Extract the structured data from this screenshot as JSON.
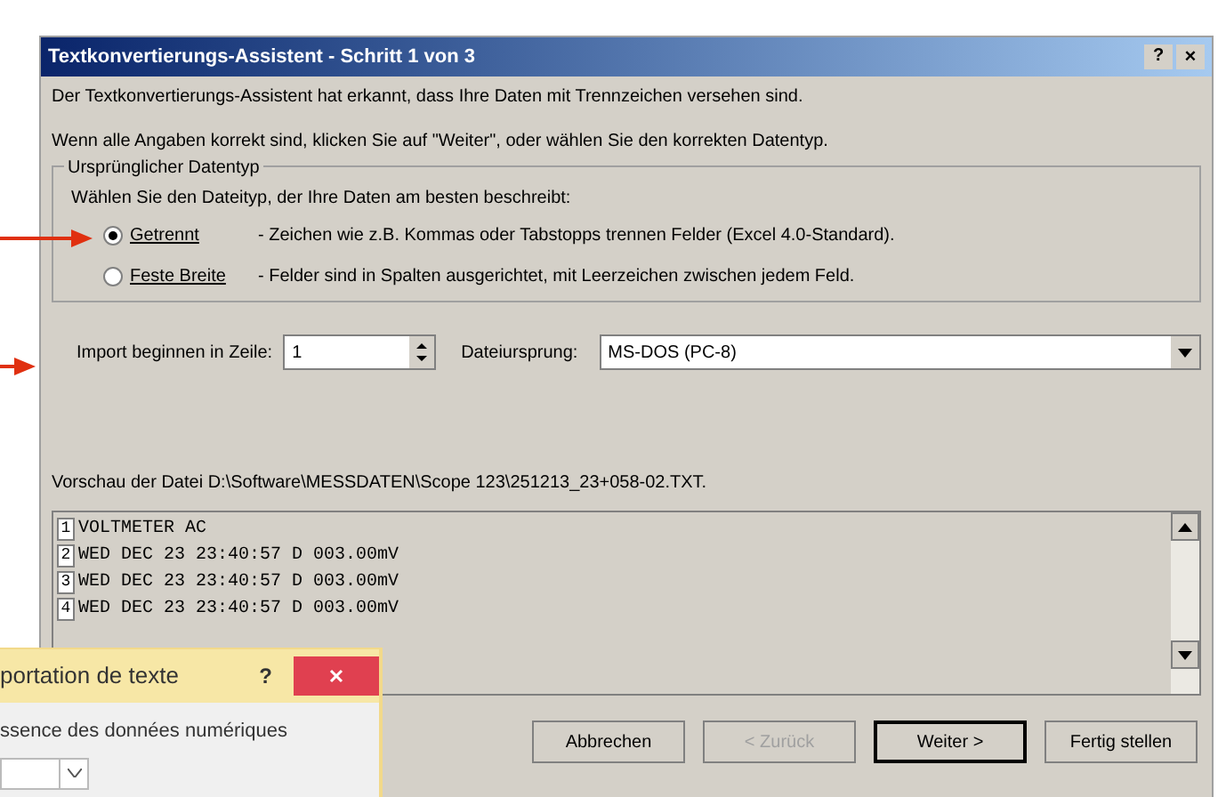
{
  "window": {
    "title": "Textkonvertierungs-Assistent - Schritt 1 von 3",
    "help": "?",
    "close": "×"
  },
  "intro": [
    "Der Textkonvertierungs-Assistent hat erkannt, dass Ihre Daten mit Trennzeichen versehen sind.",
    "Wenn alle Angaben korrekt sind, klicken Sie auf \"Weiter\", oder wählen Sie den korrekten Datentyp."
  ],
  "data_type": {
    "legend": "Ursprünglicher Datentyp",
    "prompt": "Wählen Sie den Dateityp, der Ihre Daten am besten beschreibt:",
    "options": [
      {
        "label": "Getrennt",
        "description": "- Zeichen wie z.B. Kommas oder Tabstopps trennen Felder (Excel 4.0-Standard).",
        "selected": true
      },
      {
        "label": "Feste Breite",
        "description": "- Felder sind in Spalten ausgerichtet, mit Leerzeichen zwischen jedem Feld.",
        "selected": false
      }
    ]
  },
  "start_row": {
    "label": "Import beginnen in Zeile:",
    "value": "1"
  },
  "origin": {
    "label": "Dateiursprung:",
    "value": "MS-DOS (PC-8)"
  },
  "preview": {
    "label": "Vorschau der Datei D:\\Software\\MESSDATEN\\Scope 123\\251213_23+058-02.TXT.",
    "rows": [
      {
        "number": "1",
        "text": "VOLTMETER AC"
      },
      {
        "number": "2",
        "text": "WED DEC 23 23:40:57 D 003.00mV"
      },
      {
        "number": "3",
        "text": "WED DEC 23 23:40:57 D 003.00mV"
      },
      {
        "number": "4",
        "text": "WED DEC 23 23:40:57 D 003.00mV"
      }
    ]
  },
  "buttons": [
    {
      "label": "Abbrechen",
      "disabled": false,
      "default": false
    },
    {
      "label": "< Zurück",
      "disabled": true,
      "default": false
    },
    {
      "label": "Weiter >",
      "disabled": false,
      "default": true
    },
    {
      "label": "Fertig stellen",
      "disabled": false,
      "default": false
    }
  ],
  "overlay_dialog": {
    "title": "portation de texte",
    "help": "?",
    "text": "ssence des données numériques"
  }
}
